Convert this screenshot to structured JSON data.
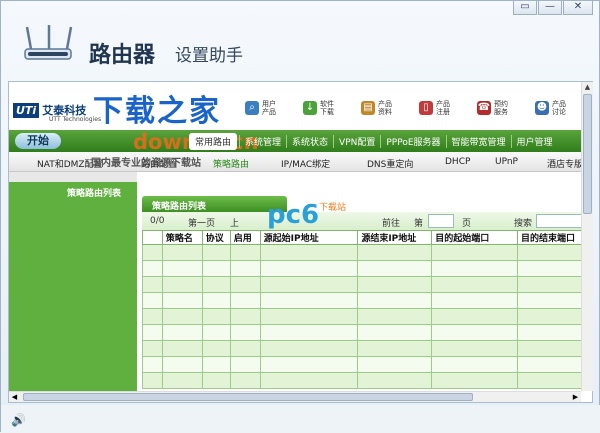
{
  "window": {
    "title": "路由器",
    "subtitle": "设置助手",
    "controls": [
      "▭",
      "—",
      "✕"
    ]
  },
  "header": {
    "logo_badge": "UTi",
    "logo_text": "艾泰科技",
    "logo_sub": "UTT Technologies",
    "watermark": "下载之家",
    "watermark2": "downza.cn",
    "tools": [
      {
        "label": "用户 产品",
        "icon": "search-icon",
        "color": "#3a7fc0"
      },
      {
        "label": "软件 下载",
        "icon": "download-arrow-icon",
        "color": "#4aa33a"
      },
      {
        "label": "产品 资料",
        "icon": "books-icon",
        "color": "#c0862a"
      },
      {
        "label": "产品 注册",
        "icon": "document-icon",
        "color": "#c23a3a"
      },
      {
        "label": "预约 服务",
        "icon": "phone-icon",
        "color": "#b52a2a"
      },
      {
        "label": "产品 讨论",
        "icon": "users-icon",
        "color": "#3a6fb0"
      }
    ]
  },
  "nav": {
    "start": "开始",
    "watermark": "downza.cn",
    "selected": "常用路由",
    "items": [
      "系统管理",
      "系统状态",
      "VPN配置",
      "PPPoE服务器",
      "智能带宽管理",
      "用户管理"
    ]
  },
  "subnav": {
    "watermark": "国内最专业的资源下载站",
    "items": [
      "NAT和DMZ配置",
      "路由配置",
      "策略路由",
      "IP/MAC绑定",
      "DNS重定向",
      "DHCP",
      "UPnP",
      "酒店专版"
    ]
  },
  "sidebar": {
    "items": [
      "策略路由列表"
    ]
  },
  "panel": {
    "title": "策略路由列表",
    "count": "0/0",
    "first_page": "第一页",
    "prev_page": "上",
    "goto_label": "前往",
    "page_prefix": "第",
    "page_suffix": "页",
    "search_label": "搜索",
    "pc6_logo": "pc6",
    "pc6_sub": "下载站"
  },
  "table": {
    "columns": [
      "",
      "策略名",
      "协议",
      "启用",
      "源起始IP地址",
      "源结束IP地址",
      "目的起始端口",
      "目的结束端口"
    ],
    "row_count": 9
  },
  "colors": {
    "nav_green": "#3e8f24",
    "row_green": "#e2f3d6",
    "sidebar_green": "#5fb03e"
  }
}
